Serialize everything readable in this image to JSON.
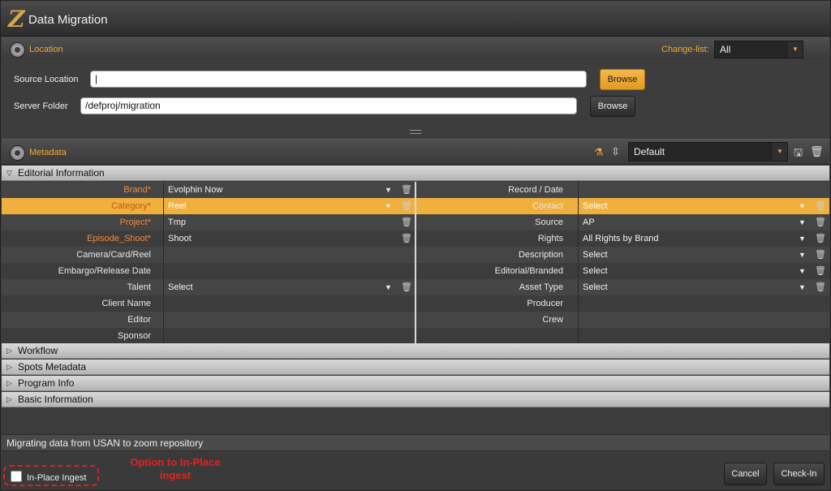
{
  "window": {
    "title": "Data Migration"
  },
  "location": {
    "title": "Location",
    "changelist_label": "Change-list:",
    "changelist_value": "All",
    "source_label": "Source Location",
    "source_value": "",
    "server_label": "Server Folder",
    "server_value": "/defproj/migration",
    "browse_label": "Browse"
  },
  "metadata": {
    "title": "Metadata",
    "template_value": "Default"
  },
  "groups": {
    "editorial": "Editorial Information",
    "workflow": "Workflow",
    "spots": "Spots Metadata",
    "program": "Program Info",
    "basic": "Basic Information"
  },
  "left_rows": [
    {
      "label": "Brand*",
      "value": "Evolphin Now",
      "required": true,
      "dropdown": true,
      "trash": true
    },
    {
      "label": "Category*",
      "value": "Reel",
      "required": true,
      "dropdown": true,
      "trash": true,
      "selected": true
    },
    {
      "label": "Project*",
      "value": "Tmp",
      "required": true,
      "dropdown": false,
      "trash": true
    },
    {
      "label": "Episode_Shoot*",
      "value": "Shoot",
      "required": true,
      "dropdown": false,
      "trash": true
    },
    {
      "label": "Camera/Card/Reel",
      "value": ""
    },
    {
      "label": "Embargo/Release Date",
      "value": ""
    },
    {
      "label": "Talent",
      "value": "Select",
      "dropdown": true,
      "trash": true
    },
    {
      "label": "Client Name",
      "value": ""
    },
    {
      "label": "Editor",
      "value": ""
    },
    {
      "label": "Sponsor",
      "value": ""
    }
  ],
  "right_rows": [
    {
      "label": "Record / Date",
      "value": ""
    },
    {
      "label": "Contact",
      "value": "Select",
      "dropdown": true,
      "trash": true
    },
    {
      "label": "Source",
      "value": "AP",
      "dropdown": true,
      "trash": true
    },
    {
      "label": "Rights",
      "value": "All Rights by Brand",
      "dropdown": true,
      "trash": true
    },
    {
      "label": "Description",
      "value": "Select",
      "dropdown": true,
      "trash": true
    },
    {
      "label": "Editorial/Branded",
      "value": "Select",
      "dropdown": true,
      "trash": true
    },
    {
      "label": "Asset Type",
      "value": "Select",
      "dropdown": true,
      "trash": true
    },
    {
      "label": "Producer",
      "value": ""
    },
    {
      "label": "Crew",
      "value": ""
    },
    {
      "label": "",
      "value": ""
    }
  ],
  "status": {
    "message": "Migrating data from USAN to zoom repository"
  },
  "footer": {
    "inplace_label": "In-Place Ingest",
    "annotation": "Option to In-Place ingest",
    "cancel_label": "Cancel",
    "checkin_label": "Check-In"
  },
  "colors": {
    "accent": "#f0a830",
    "selected_row": "#f0b03e",
    "required_label": "#f08a3a",
    "annotation": "#e02020"
  }
}
